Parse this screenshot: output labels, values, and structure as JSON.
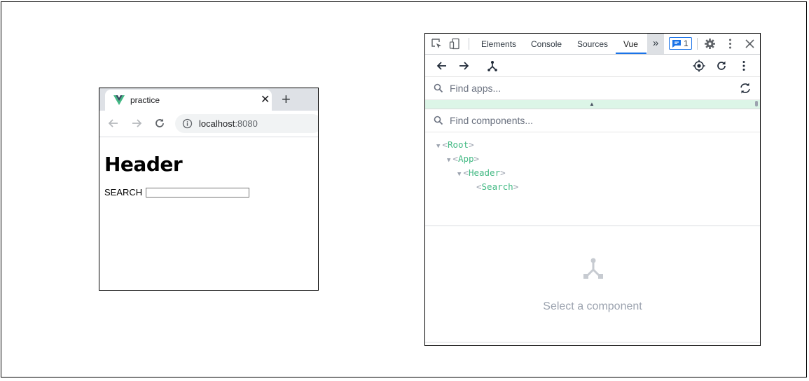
{
  "browser": {
    "tab_title": "practice",
    "close_glyph": "✕",
    "new_tab_glyph": "+",
    "url_host": "localhost",
    "url_port": ":8080",
    "page": {
      "heading": "Header",
      "search_label": "SEARCH",
      "search_value": ""
    }
  },
  "devtools": {
    "tabs": [
      {
        "label": "Elements",
        "active": false
      },
      {
        "label": "Console",
        "active": false
      },
      {
        "label": "Sources",
        "active": false
      },
      {
        "label": "Vue",
        "active": true
      }
    ],
    "overflow_glyph": "»",
    "issues_count": "1",
    "accent_color": "#1a73e8",
    "vue": {
      "find_apps_placeholder": "Find apps...",
      "find_components_placeholder": "Find components...",
      "tree": [
        {
          "name": "Root",
          "expanded": true
        },
        {
          "name": "App",
          "expanded": true
        },
        {
          "name": "Header",
          "expanded": true
        },
        {
          "name": "Search",
          "expanded": false
        }
      ],
      "empty_message": "Select a component",
      "node_color": "#42b983"
    }
  }
}
